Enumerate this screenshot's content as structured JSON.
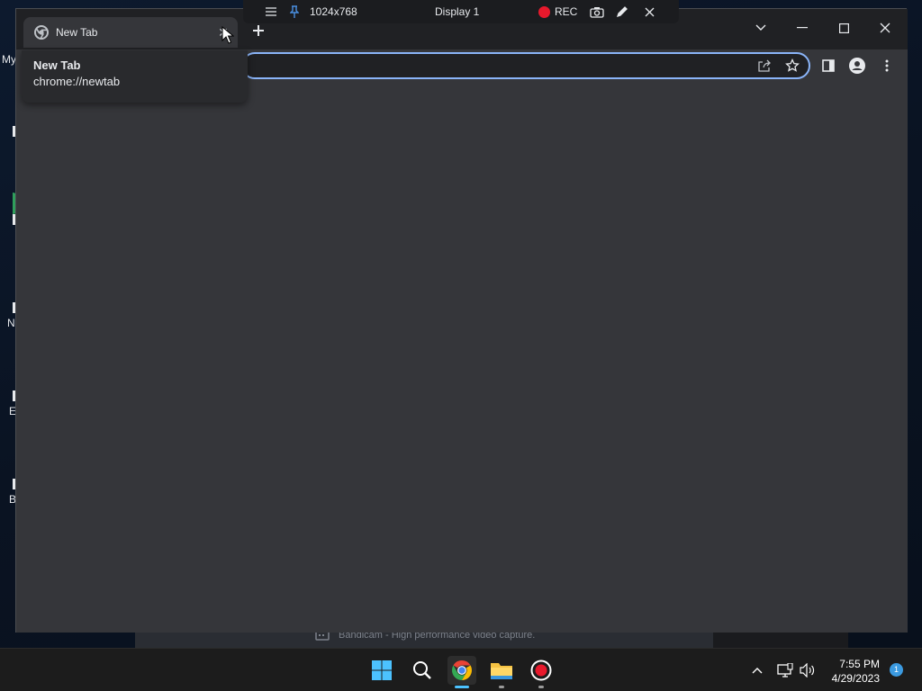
{
  "desktop": {
    "fragments": [
      "My",
      "N",
      "E",
      "B"
    ]
  },
  "bandicam_strip": {
    "text": "Bandicam - High performance video capture."
  },
  "rec_bar": {
    "resolution": "1024x768",
    "display": "Display 1",
    "rec_label": "REC",
    "rec_color": "#e8192c"
  },
  "browser": {
    "tab": {
      "title": "New Tab",
      "close_icon": "close-icon"
    },
    "new_tab_icon": "plus-icon",
    "hover_card": {
      "title": "New Tab",
      "url": "chrome://newtab"
    },
    "toolbar_icons": [
      "share-icon",
      "star-icon",
      "side-panel-icon",
      "profile-icon",
      "kebab-menu-icon"
    ],
    "window_controls": [
      "tab-search-icon",
      "minimize-icon",
      "maximize-icon",
      "close-icon"
    ],
    "accent_color": "#8ab4f8",
    "content_bg": "#35363a"
  },
  "taskbar": {
    "apps": [
      "windows-start-icon",
      "search-icon",
      "chrome-icon",
      "file-explorer-icon",
      "bandicam-record-icon"
    ],
    "tray": {
      "time": "7:55 PM",
      "date": "4/29/2023",
      "notifications": "1"
    }
  }
}
